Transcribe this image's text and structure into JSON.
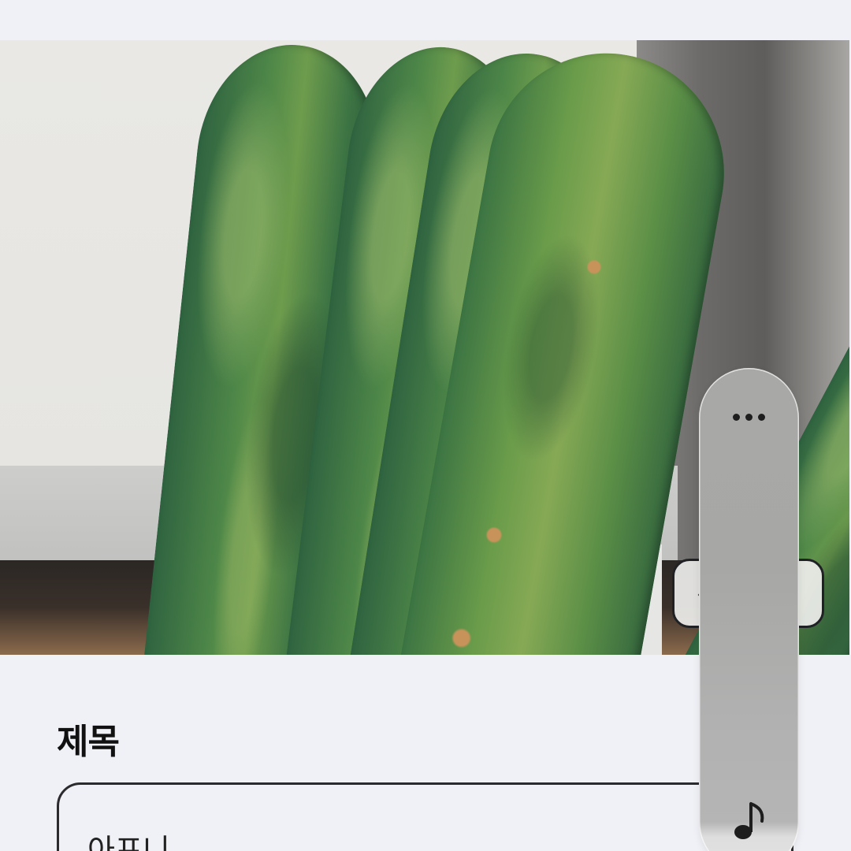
{
  "form": {
    "title_label": "제목",
    "title_value": "아프니"
  },
  "icons": {
    "more": "more-horizontal-icon",
    "music": "music-note-icon",
    "overlay": "chevron-left-icon"
  },
  "colors": {
    "background": "#f0f1f6",
    "panel": "#a8a9a6",
    "text": "#111111",
    "border": "#2b2b2e"
  }
}
